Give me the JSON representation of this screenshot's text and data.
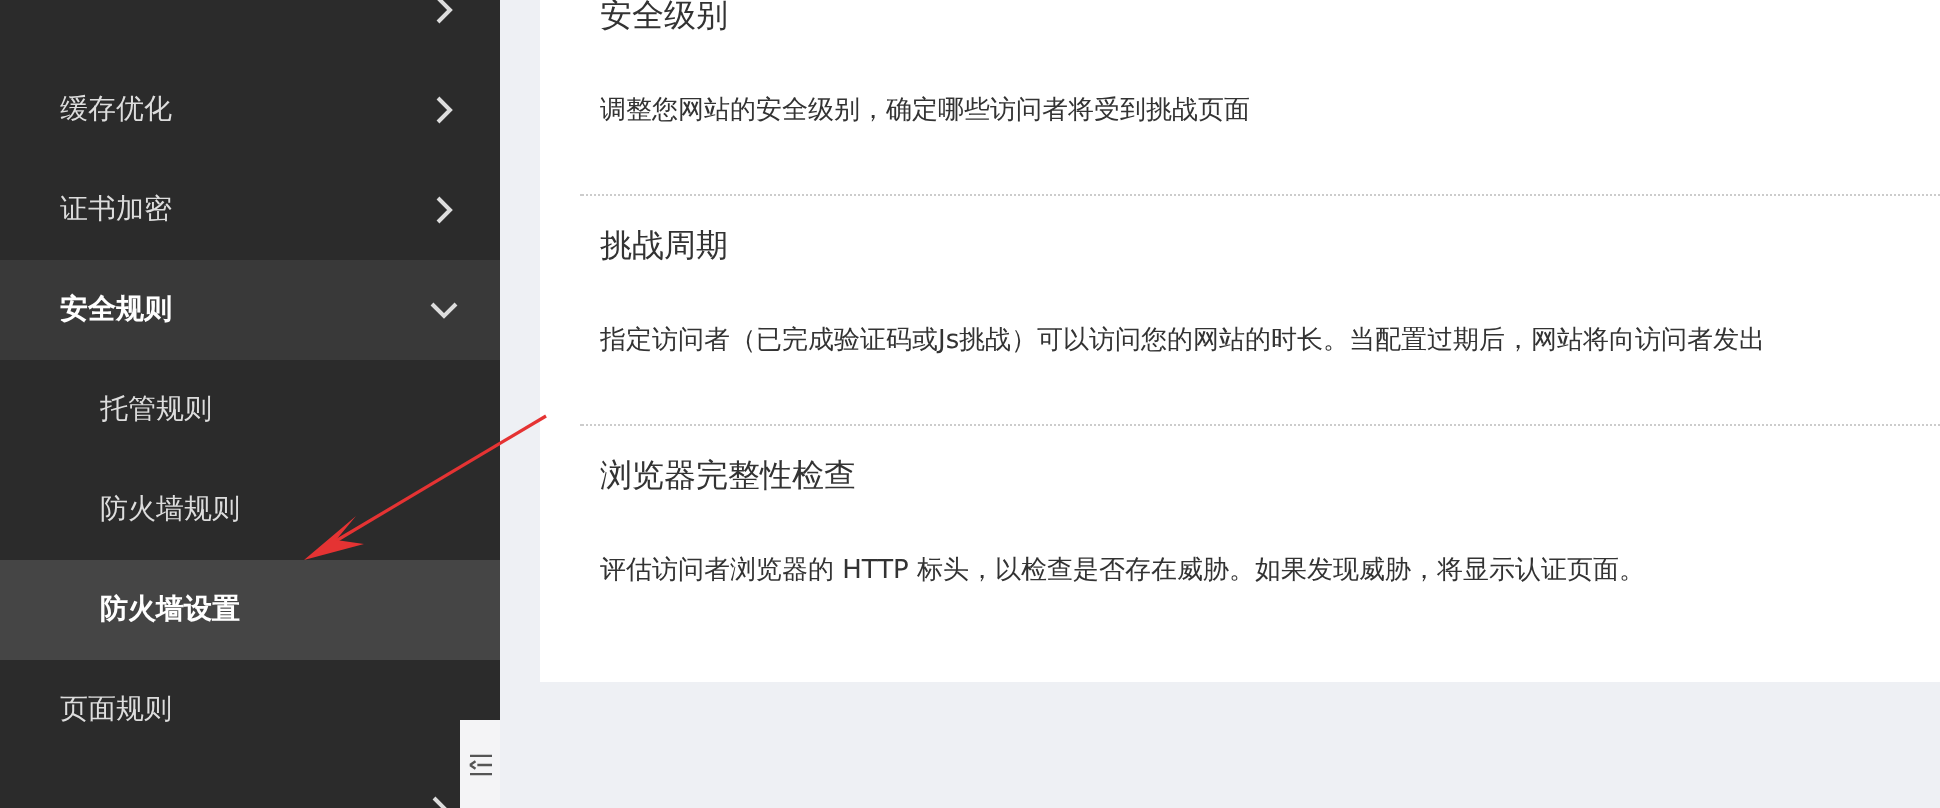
{
  "sidebar": {
    "items": [
      {
        "kind": "group",
        "expanded": false,
        "selected": false
      },
      {
        "kind": "group",
        "label": "缓存优化",
        "expanded": false,
        "selected": false
      },
      {
        "kind": "group",
        "label": "证书加密",
        "expanded": false,
        "selected": false
      },
      {
        "kind": "group",
        "label": "安全规则",
        "expanded": true,
        "selected": false
      },
      {
        "kind": "child",
        "label": "托管规则",
        "selected": false
      },
      {
        "kind": "child",
        "label": "防火墙规则",
        "selected": false
      },
      {
        "kind": "child",
        "label": "防火墙设置",
        "selected": true
      },
      {
        "kind": "link",
        "label": "页面规则",
        "selected": false
      },
      {
        "kind": "group",
        "expanded": false,
        "selected": false
      }
    ]
  },
  "sections": [
    {
      "title": "安全级别",
      "description": "调整您网站的安全级别，确定哪些访问者将受到挑战页面"
    },
    {
      "title": "挑战周期",
      "description": "指定访问者（已完成验证码或Js挑战）可以访问您的网站的时长。当配置过期后，网站将向访问者发出"
    },
    {
      "title": "浏览器完整性检查",
      "description": "评估访问者浏览器的 HTTP 标头，以检查是否存在威胁。如果发现威胁，将显示认证页面。"
    }
  ]
}
